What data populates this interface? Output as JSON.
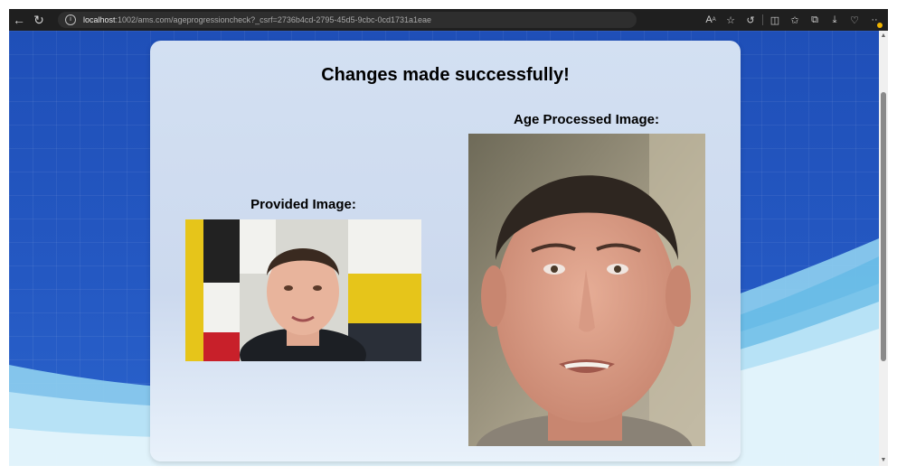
{
  "browser": {
    "back_icon": "back-arrow-icon",
    "reload_icon": "reload-icon",
    "url_host": "localhost",
    "url_rest": ":1002/ams.com/ageprogressioncheck?_csrf=2736b4cd-2795-45d5-9cbc-0cd1731a1eae",
    "toolbar_icons": [
      "read-aloud-icon",
      "favorite-star-icon",
      "copilot-icon",
      "split-screen-icon",
      "favorites-icon",
      "collections-icon",
      "downloads-icon",
      "health-icon",
      "more-icon"
    ]
  },
  "page": {
    "title": "Changes made successfully!",
    "provided_label": "Provided Image:",
    "processed_label": "Age Processed Image:"
  },
  "colors": {
    "background_blue": "#2458c2",
    "card": "#d3e0f2",
    "wave_light": "#8fd0ef",
    "browser_bar": "#1f1f1f"
  }
}
